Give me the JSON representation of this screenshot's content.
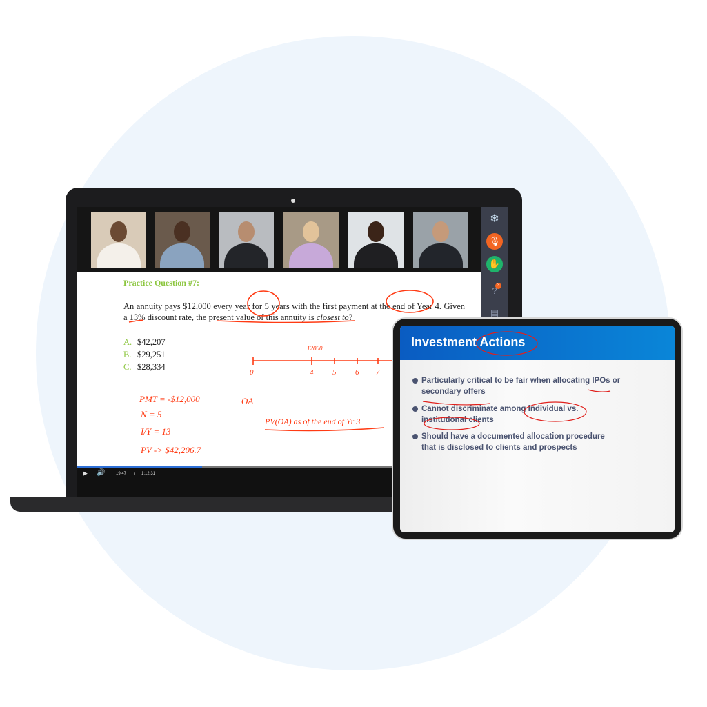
{
  "question": {
    "title": "Practice Question #7:",
    "text_html_parts": [
      "An annuity pays $12,000 every year for 5 years with the first payment at the end of Year 4. Given a 13% discount rate, the present value of this annuity is ",
      "closest to",
      "?"
    ],
    "options": [
      {
        "letter": "A.",
        "value": "$42,207"
      },
      {
        "letter": "B.",
        "value": "$29,251"
      },
      {
        "letter": "C.",
        "value": "$28,334"
      }
    ]
  },
  "annotations": {
    "timeline_top": "12000",
    "ticks": [
      "0",
      "4",
      "5",
      "6",
      "7"
    ],
    "oa": "OA",
    "pmt": "PMT = -$12,000",
    "n": "N = 5",
    "iy": "I/Y = 13",
    "pv": "PV -> $42,206.7",
    "pv_oa": "PV(OA) as of the end of Yr 3",
    "color": "#ff3b14"
  },
  "player": {
    "current": "19:47",
    "sep": "/",
    "total": "1:12:31",
    "progress": 0.31
  },
  "sidebar": {
    "icons": [
      "snowflake-icon",
      "mic-off-icon",
      "raise-hand-icon",
      "question-icon",
      "notes-icon"
    ],
    "question_badge": "3"
  },
  "participants": 6,
  "slide": {
    "title": "Investment Actions",
    "bullets": [
      "Particularly critical to be fair when allocating IPOs or secondary offers",
      "Cannot discriminate among individual vs. institutional clients",
      "Should have a documented allocation procedure that is disclosed to clients and prospects"
    ]
  },
  "colors": {
    "accent_green": "#8cc63f",
    "slide_blue": "#0a6fd0",
    "background": "#eef5fc"
  }
}
